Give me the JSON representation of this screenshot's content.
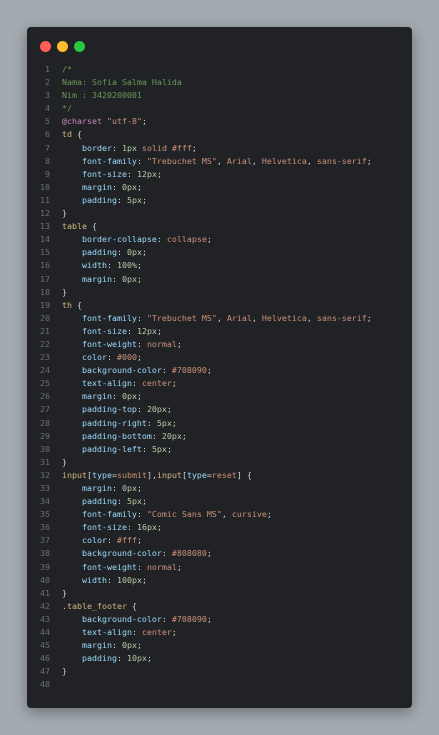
{
  "window": {
    "buttons": [
      {
        "name": "close",
        "color": "#ff5f57"
      },
      {
        "name": "minimize",
        "color": "#febc2e"
      },
      {
        "name": "zoom",
        "color": "#28c840"
      }
    ]
  },
  "colors": {
    "comment": "#6a9955",
    "selector": "#d7ba7d",
    "property": "#9cdcfe",
    "value": "#ce9178",
    "at_rule": "#c586c0",
    "number": "#b5cea8",
    "text": "#d4d4d4"
  },
  "lines": [
    {
      "n": "1",
      "tokens": [
        {
          "t": "/*",
          "c": "cm"
        }
      ]
    },
    {
      "n": "2",
      "tokens": [
        {
          "t": "Nama: Sofia Salma Halida",
          "c": "cm"
        }
      ]
    },
    {
      "n": "3",
      "tokens": [
        {
          "t": "Nim : 3420200001",
          "c": "cm"
        }
      ]
    },
    {
      "n": "4",
      "tokens": [
        {
          "t": "*/",
          "c": "cm"
        }
      ]
    },
    {
      "n": "5",
      "tokens": [
        {
          "t": "@charset",
          "c": "kw"
        },
        {
          "t": " ",
          "c": ""
        },
        {
          "t": "\"utf-8\"",
          "c": "str"
        },
        {
          "t": ";",
          "c": ""
        }
      ]
    },
    {
      "n": "6",
      "tokens": [
        {
          "t": "td",
          "c": "sel"
        },
        {
          "t": " {",
          "c": ""
        }
      ]
    },
    {
      "n": "7",
      "tokens": [
        {
          "t": "    ",
          "c": ""
        },
        {
          "t": "border",
          "c": "prop"
        },
        {
          "t": ": ",
          "c": ""
        },
        {
          "t": "1px",
          "c": "num"
        },
        {
          "t": " solid #fff",
          "c": "val"
        },
        {
          "t": ";",
          "c": ""
        }
      ]
    },
    {
      "n": "8",
      "tokens": [
        {
          "t": "    ",
          "c": ""
        },
        {
          "t": "font-family",
          "c": "prop"
        },
        {
          "t": ": ",
          "c": ""
        },
        {
          "t": "\"Trebuchet MS\"",
          "c": "str"
        },
        {
          "t": ", ",
          "c": ""
        },
        {
          "t": "Arial",
          "c": "val"
        },
        {
          "t": ", ",
          "c": ""
        },
        {
          "t": "Helvetica",
          "c": "val"
        },
        {
          "t": ", ",
          "c": ""
        },
        {
          "t": "sans-serif",
          "c": "val"
        },
        {
          "t": ";",
          "c": ""
        }
      ]
    },
    {
      "n": "9",
      "tokens": [
        {
          "t": "    ",
          "c": ""
        },
        {
          "t": "font-size",
          "c": "prop"
        },
        {
          "t": ": ",
          "c": ""
        },
        {
          "t": "12px",
          "c": "num"
        },
        {
          "t": ";",
          "c": ""
        }
      ]
    },
    {
      "n": "10",
      "tokens": [
        {
          "t": "    ",
          "c": ""
        },
        {
          "t": "margin",
          "c": "prop"
        },
        {
          "t": ": ",
          "c": ""
        },
        {
          "t": "0px",
          "c": "num"
        },
        {
          "t": ";",
          "c": ""
        }
      ]
    },
    {
      "n": "11",
      "tokens": [
        {
          "t": "    ",
          "c": ""
        },
        {
          "t": "padding",
          "c": "prop"
        },
        {
          "t": ": ",
          "c": ""
        },
        {
          "t": "5px",
          "c": "num"
        },
        {
          "t": ";",
          "c": ""
        }
      ]
    },
    {
      "n": "12",
      "tokens": [
        {
          "t": "}",
          "c": ""
        }
      ]
    },
    {
      "n": "13",
      "tokens": [
        {
          "t": "table",
          "c": "sel"
        },
        {
          "t": " {",
          "c": ""
        }
      ]
    },
    {
      "n": "14",
      "tokens": [
        {
          "t": "    ",
          "c": ""
        },
        {
          "t": "border-collapse",
          "c": "prop"
        },
        {
          "t": ": ",
          "c": ""
        },
        {
          "t": "collapse",
          "c": "val"
        },
        {
          "t": ";",
          "c": ""
        }
      ]
    },
    {
      "n": "15",
      "tokens": [
        {
          "t": "    ",
          "c": ""
        },
        {
          "t": "padding",
          "c": "prop"
        },
        {
          "t": ": ",
          "c": ""
        },
        {
          "t": "0px",
          "c": "num"
        },
        {
          "t": ";",
          "c": ""
        }
      ]
    },
    {
      "n": "16",
      "tokens": [
        {
          "t": "    ",
          "c": ""
        },
        {
          "t": "width",
          "c": "prop"
        },
        {
          "t": ": ",
          "c": ""
        },
        {
          "t": "100%",
          "c": "num"
        },
        {
          "t": ";",
          "c": ""
        }
      ]
    },
    {
      "n": "17",
      "tokens": [
        {
          "t": "    ",
          "c": ""
        },
        {
          "t": "margin",
          "c": "prop"
        },
        {
          "t": ": ",
          "c": ""
        },
        {
          "t": "0px",
          "c": "num"
        },
        {
          "t": ";",
          "c": ""
        }
      ]
    },
    {
      "n": "18",
      "tokens": [
        {
          "t": "}",
          "c": ""
        }
      ]
    },
    {
      "n": "19",
      "tokens": [
        {
          "t": "th",
          "c": "sel"
        },
        {
          "t": " {",
          "c": ""
        }
      ]
    },
    {
      "n": "20",
      "tokens": [
        {
          "t": "    ",
          "c": ""
        },
        {
          "t": "font-family",
          "c": "prop"
        },
        {
          "t": ": ",
          "c": ""
        },
        {
          "t": "\"Trebuchet MS\"",
          "c": "str"
        },
        {
          "t": ", ",
          "c": ""
        },
        {
          "t": "Arial",
          "c": "val"
        },
        {
          "t": ", ",
          "c": ""
        },
        {
          "t": "Helvetica",
          "c": "val"
        },
        {
          "t": ", ",
          "c": ""
        },
        {
          "t": "sans-serif",
          "c": "val"
        },
        {
          "t": ";",
          "c": ""
        }
      ]
    },
    {
      "n": "21",
      "tokens": [
        {
          "t": "    ",
          "c": ""
        },
        {
          "t": "font-size",
          "c": "prop"
        },
        {
          "t": ": ",
          "c": ""
        },
        {
          "t": "12px",
          "c": "num"
        },
        {
          "t": ";",
          "c": ""
        }
      ]
    },
    {
      "n": "22",
      "tokens": [
        {
          "t": "    ",
          "c": ""
        },
        {
          "t": "font-weight",
          "c": "prop"
        },
        {
          "t": ": ",
          "c": ""
        },
        {
          "t": "normal",
          "c": "val"
        },
        {
          "t": ";",
          "c": ""
        }
      ]
    },
    {
      "n": "23",
      "tokens": [
        {
          "t": "    ",
          "c": ""
        },
        {
          "t": "color",
          "c": "prop"
        },
        {
          "t": ": ",
          "c": ""
        },
        {
          "t": "#000",
          "c": "val"
        },
        {
          "t": ";",
          "c": ""
        }
      ]
    },
    {
      "n": "24",
      "tokens": [
        {
          "t": "    ",
          "c": ""
        },
        {
          "t": "background-color",
          "c": "prop"
        },
        {
          "t": ": ",
          "c": ""
        },
        {
          "t": "#708090",
          "c": "val"
        },
        {
          "t": ";",
          "c": ""
        }
      ]
    },
    {
      "n": "25",
      "tokens": [
        {
          "t": "    ",
          "c": ""
        },
        {
          "t": "text-align",
          "c": "prop"
        },
        {
          "t": ": ",
          "c": ""
        },
        {
          "t": "center",
          "c": "val"
        },
        {
          "t": ";",
          "c": ""
        }
      ]
    },
    {
      "n": "26",
      "tokens": [
        {
          "t": "    ",
          "c": ""
        },
        {
          "t": "margin",
          "c": "prop"
        },
        {
          "t": ": ",
          "c": ""
        },
        {
          "t": "0px",
          "c": "num"
        },
        {
          "t": ";",
          "c": ""
        }
      ]
    },
    {
      "n": "27",
      "tokens": [
        {
          "t": "    ",
          "c": ""
        },
        {
          "t": "padding-top",
          "c": "prop"
        },
        {
          "t": ": ",
          "c": ""
        },
        {
          "t": "20px",
          "c": "num"
        },
        {
          "t": ";",
          "c": ""
        }
      ]
    },
    {
      "n": "28",
      "tokens": [
        {
          "t": "    ",
          "c": ""
        },
        {
          "t": "padding-right",
          "c": "prop"
        },
        {
          "t": ": ",
          "c": ""
        },
        {
          "t": "5px",
          "c": "num"
        },
        {
          "t": ";",
          "c": ""
        }
      ]
    },
    {
      "n": "29",
      "tokens": [
        {
          "t": "    ",
          "c": ""
        },
        {
          "t": "padding-bottom",
          "c": "prop"
        },
        {
          "t": ": ",
          "c": ""
        },
        {
          "t": "20px",
          "c": "num"
        },
        {
          "t": ";",
          "c": ""
        }
      ]
    },
    {
      "n": "30",
      "tokens": [
        {
          "t": "    ",
          "c": ""
        },
        {
          "t": "padding-left",
          "c": "prop"
        },
        {
          "t": ": ",
          "c": ""
        },
        {
          "t": "5px",
          "c": "num"
        },
        {
          "t": ";",
          "c": ""
        }
      ]
    },
    {
      "n": "31",
      "tokens": [
        {
          "t": "}",
          "c": ""
        }
      ]
    },
    {
      "n": "32",
      "tokens": [
        {
          "t": "input",
          "c": "sel"
        },
        {
          "t": "[",
          "c": ""
        },
        {
          "t": "type",
          "c": "prop"
        },
        {
          "t": "=",
          "c": ""
        },
        {
          "t": "submit",
          "c": "val"
        },
        {
          "t": "],",
          "c": ""
        },
        {
          "t": "input",
          "c": "sel"
        },
        {
          "t": "[",
          "c": ""
        },
        {
          "t": "type",
          "c": "prop"
        },
        {
          "t": "=",
          "c": ""
        },
        {
          "t": "reset",
          "c": "val"
        },
        {
          "t": "] {",
          "c": ""
        }
      ]
    },
    {
      "n": "33",
      "tokens": [
        {
          "t": "    ",
          "c": ""
        },
        {
          "t": "margin",
          "c": "prop"
        },
        {
          "t": ": ",
          "c": ""
        },
        {
          "t": "0px",
          "c": "num"
        },
        {
          "t": ";",
          "c": ""
        }
      ]
    },
    {
      "n": "34",
      "tokens": [
        {
          "t": "    ",
          "c": ""
        },
        {
          "t": "padding",
          "c": "prop"
        },
        {
          "t": ": ",
          "c": ""
        },
        {
          "t": "5px",
          "c": "num"
        },
        {
          "t": ";",
          "c": ""
        }
      ]
    },
    {
      "n": "35",
      "tokens": [
        {
          "t": "    ",
          "c": ""
        },
        {
          "t": "font-family",
          "c": "prop"
        },
        {
          "t": ": ",
          "c": ""
        },
        {
          "t": "\"Comic Sans MS\"",
          "c": "str"
        },
        {
          "t": ", ",
          "c": ""
        },
        {
          "t": "cursive",
          "c": "val"
        },
        {
          "t": ";",
          "c": ""
        }
      ]
    },
    {
      "n": "36",
      "tokens": [
        {
          "t": "    ",
          "c": ""
        },
        {
          "t": "font-size",
          "c": "prop"
        },
        {
          "t": ": ",
          "c": ""
        },
        {
          "t": "16px",
          "c": "num"
        },
        {
          "t": ";",
          "c": ""
        }
      ]
    },
    {
      "n": "37",
      "tokens": [
        {
          "t": "    ",
          "c": ""
        },
        {
          "t": "color",
          "c": "prop"
        },
        {
          "t": ": ",
          "c": ""
        },
        {
          "t": "#fff",
          "c": "val"
        },
        {
          "t": ";",
          "c": ""
        }
      ]
    },
    {
      "n": "38",
      "tokens": [
        {
          "t": "    ",
          "c": ""
        },
        {
          "t": "background-color",
          "c": "prop"
        },
        {
          "t": ": ",
          "c": ""
        },
        {
          "t": "#808080",
          "c": "val"
        },
        {
          "t": ";",
          "c": ""
        }
      ]
    },
    {
      "n": "39",
      "tokens": [
        {
          "t": "    ",
          "c": ""
        },
        {
          "t": "font-weight",
          "c": "prop"
        },
        {
          "t": ": ",
          "c": ""
        },
        {
          "t": "normal",
          "c": "val"
        },
        {
          "t": ";",
          "c": ""
        }
      ]
    },
    {
      "n": "40",
      "tokens": [
        {
          "t": "    ",
          "c": ""
        },
        {
          "t": "width",
          "c": "prop"
        },
        {
          "t": ": ",
          "c": ""
        },
        {
          "t": "100px",
          "c": "num"
        },
        {
          "t": ";",
          "c": ""
        }
      ]
    },
    {
      "n": "41",
      "tokens": [
        {
          "t": "}",
          "c": ""
        }
      ]
    },
    {
      "n": "42",
      "tokens": [
        {
          "t": ".table_footer",
          "c": "sel"
        },
        {
          "t": " {",
          "c": ""
        }
      ]
    },
    {
      "n": "43",
      "tokens": [
        {
          "t": "    ",
          "c": ""
        },
        {
          "t": "background-color",
          "c": "prop"
        },
        {
          "t": ": ",
          "c": ""
        },
        {
          "t": "#708090",
          "c": "val"
        },
        {
          "t": ";",
          "c": ""
        }
      ]
    },
    {
      "n": "44",
      "tokens": [
        {
          "t": "    ",
          "c": ""
        },
        {
          "t": "text-align",
          "c": "prop"
        },
        {
          "t": ": ",
          "c": ""
        },
        {
          "t": "center",
          "c": "val"
        },
        {
          "t": ";",
          "c": ""
        }
      ]
    },
    {
      "n": "45",
      "tokens": [
        {
          "t": "    ",
          "c": ""
        },
        {
          "t": "margin",
          "c": "prop"
        },
        {
          "t": ": ",
          "c": ""
        },
        {
          "t": "0px",
          "c": "num"
        },
        {
          "t": ";",
          "c": ""
        }
      ]
    },
    {
      "n": "46",
      "tokens": [
        {
          "t": "    ",
          "c": ""
        },
        {
          "t": "padding",
          "c": "prop"
        },
        {
          "t": ": ",
          "c": ""
        },
        {
          "t": "10px",
          "c": "num"
        },
        {
          "t": ";",
          "c": ""
        }
      ]
    },
    {
      "n": "47",
      "tokens": [
        {
          "t": "}",
          "c": ""
        }
      ]
    },
    {
      "n": "48",
      "tokens": []
    }
  ]
}
